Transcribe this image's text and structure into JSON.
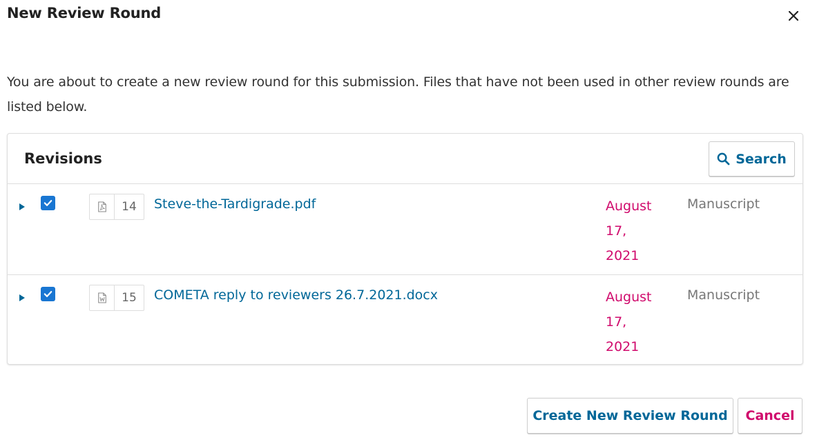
{
  "modal": {
    "title": "New Review Round",
    "intro": "You are about to create a new review round for this submission. Files that have not been used in other review rounds are listed below."
  },
  "panel": {
    "title": "Revisions",
    "search_label": "Search"
  },
  "files": [
    {
      "id": "14",
      "name": "Steve-the-Tardigrade.pdf",
      "date": "August 17, 2021",
      "type": "Manuscript",
      "icon": "pdf-file-icon",
      "checked": true
    },
    {
      "id": "15",
      "name": "COMETA reply to reviewers 26.7.2021.docx",
      "date": "August 17, 2021",
      "type": "Manuscript",
      "icon": "word-file-icon",
      "checked": true
    }
  ],
  "actions": {
    "create_label": "Create New Review Round",
    "cancel_label": "Cancel"
  },
  "colors": {
    "link": "#006798",
    "date": "#d00a6c",
    "checkbox": "#1976d2"
  }
}
